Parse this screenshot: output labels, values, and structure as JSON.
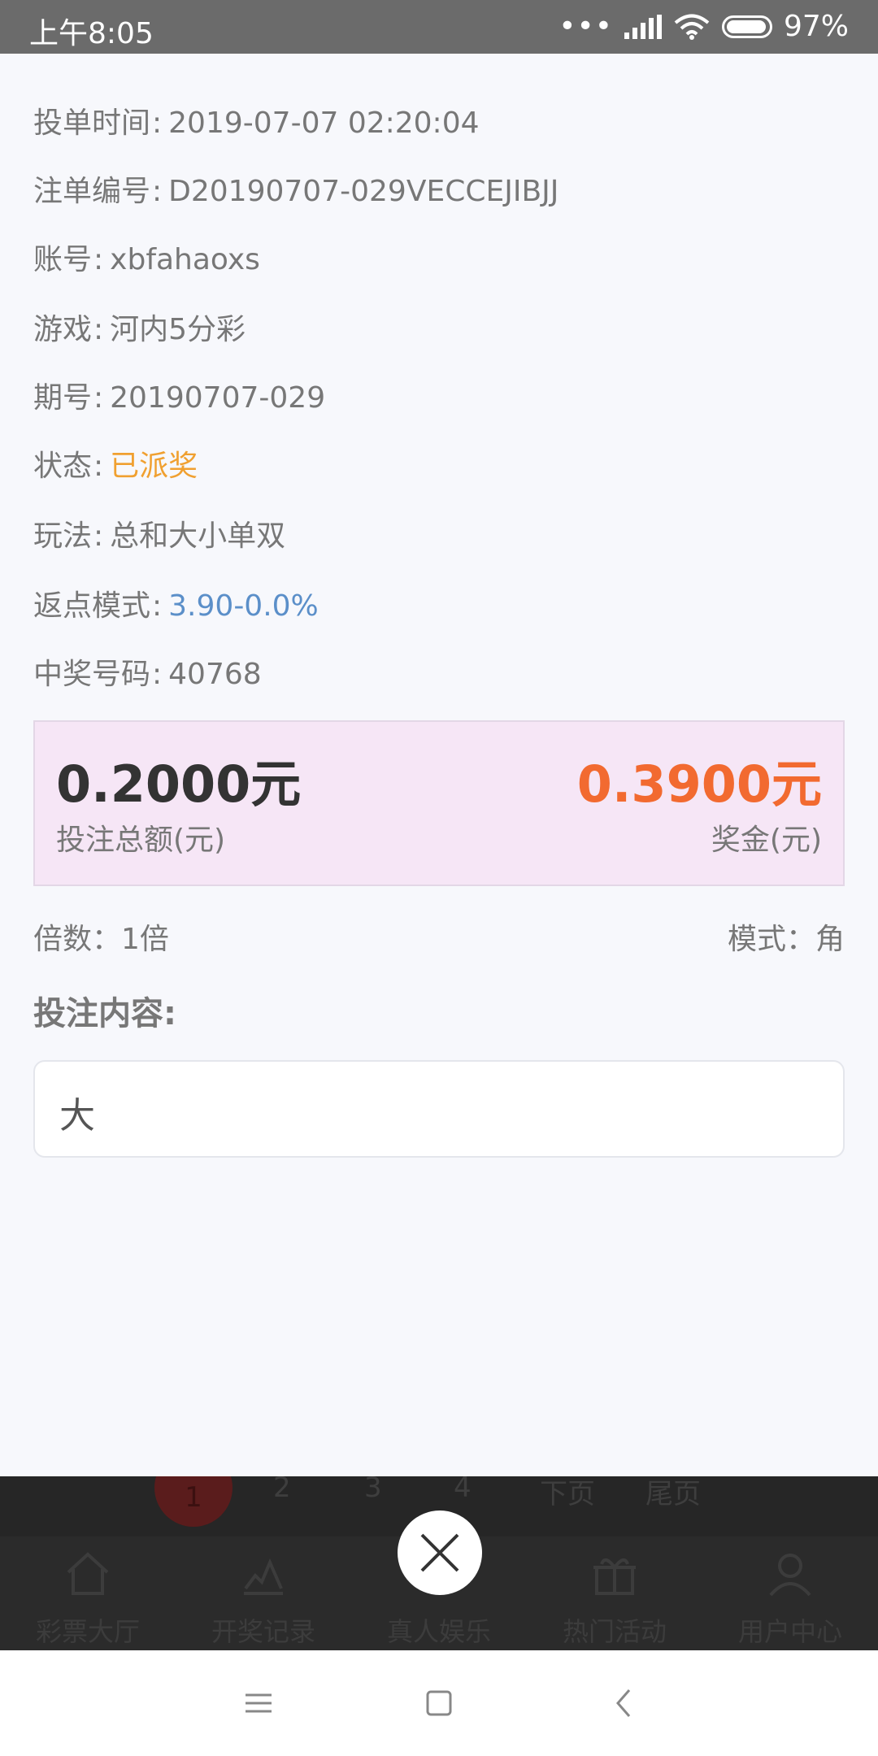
{
  "status_bar": {
    "time": "上午8:05",
    "dots": "•••",
    "battery_text": "97%",
    "battery_level": 0.97
  },
  "details": {
    "bet_time": {
      "label": "投单时间",
      "value": "2019-07-07 02:20:04"
    },
    "order_no": {
      "label": "注单编号",
      "value": "D20190707-029VECCEJIBJJ"
    },
    "account": {
      "label": "账号",
      "value": "xbfahaoxs"
    },
    "game": {
      "label": "游戏",
      "value": "河内5分彩"
    },
    "period": {
      "label": "期号",
      "value": "20190707-029"
    },
    "status": {
      "label": "状态",
      "value": "已派奖",
      "color": "#f0a030"
    },
    "play": {
      "label": "玩法",
      "value": "总和大小单双"
    },
    "rebate_mode": {
      "label": "返点模式",
      "value": "3.90-0.0%",
      "color": "#5b8fc9"
    },
    "winning_number": {
      "label": "中奖号码",
      "value": "40768"
    }
  },
  "summary": {
    "bet_amount": "0.2000元",
    "bet_amount_label": "投注总额(元)",
    "prize": "0.3900元",
    "prize_label": "奖金(元)",
    "prize_color": "#f26a30"
  },
  "multiplier": {
    "label": "倍数：",
    "value": "1倍"
  },
  "mode": {
    "label": "模式：",
    "value": "角"
  },
  "bet_content": {
    "title": "投注内容:",
    "value": "大"
  },
  "pager": {
    "current": "1",
    "items": [
      "2",
      "3",
      "4",
      "下页",
      "尾页"
    ]
  },
  "tabbar": {
    "items": [
      {
        "label": "彩票大厅",
        "icon": "home-icon"
      },
      {
        "label": "开奖记录",
        "icon": "chart-icon"
      },
      {
        "label": "真人娱乐",
        "icon": "person-icon"
      },
      {
        "label": "热门活动",
        "icon": "gift-icon"
      },
      {
        "label": "用户中心",
        "icon": "user-icon"
      }
    ]
  },
  "close_icon": "close-icon",
  "navbar": {
    "icons": [
      "menu-icon",
      "home-square-icon",
      "back-icon"
    ]
  }
}
